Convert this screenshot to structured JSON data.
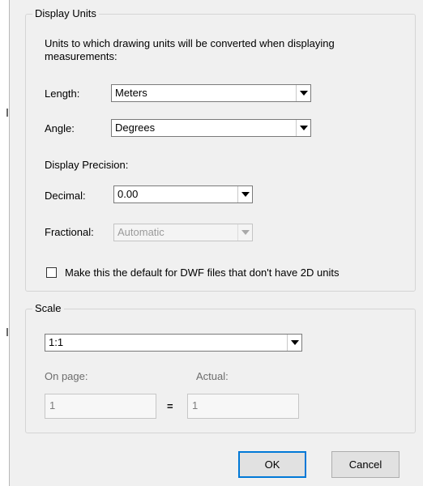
{
  "display_units": {
    "legend": "Display Units",
    "description": "Units to which drawing units will be converted when displaying measurements:",
    "length": {
      "label": "Length:",
      "value": "Meters"
    },
    "angle": {
      "label": "Angle:",
      "value": "Degrees"
    },
    "precision_heading": "Display Precision:",
    "decimal": {
      "label": "Decimal:",
      "value": "0.00"
    },
    "fractional": {
      "label": "Fractional:",
      "value": "Automatic",
      "enabled": false
    },
    "default_checkbox": {
      "label": "Make this the default for DWF files that don't have 2D units",
      "checked": false
    }
  },
  "scale": {
    "legend": "Scale",
    "value": "1:1",
    "on_page": {
      "label": "On page:",
      "value": "1"
    },
    "equals": "=",
    "actual": {
      "label": "Actual:",
      "value": "1"
    }
  },
  "buttons": {
    "ok": "OK",
    "cancel": "Cancel"
  }
}
